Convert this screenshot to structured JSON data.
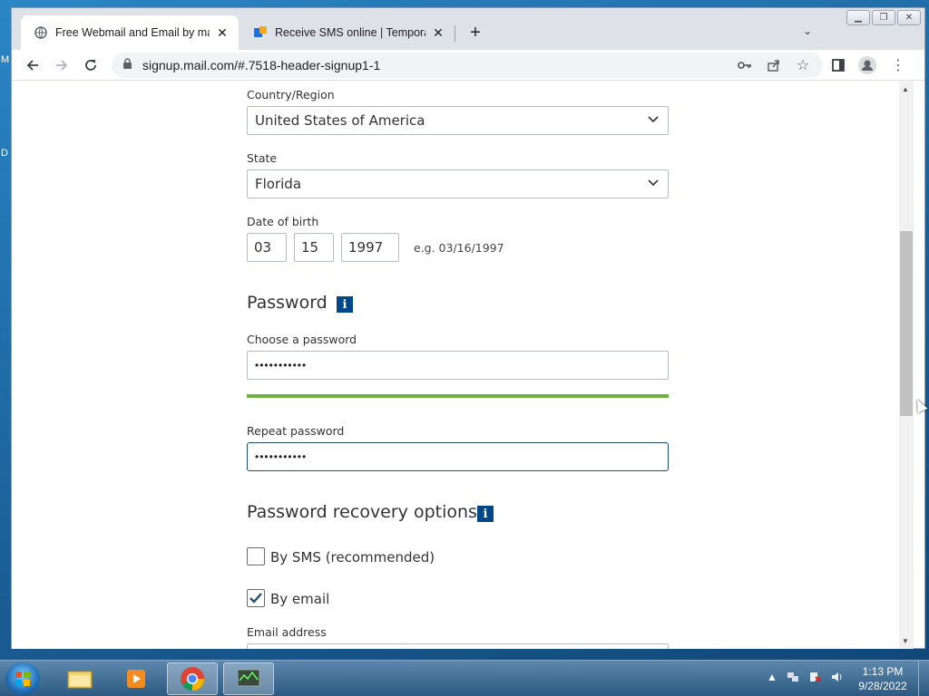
{
  "desktop": {
    "letters": [
      "M",
      "D"
    ]
  },
  "browser": {
    "tabs": [
      {
        "title": "Free Webmail and Email by mail.",
        "favicon": "globe-icon",
        "active": true
      },
      {
        "title": "Receive SMS online | Temporary N",
        "favicon": "sms-site-icon",
        "active": false
      }
    ],
    "url": "signup.mail.com/#.7518-header-signup1-1"
  },
  "form": {
    "country_label": "Country/Region",
    "country_value": "United States of America",
    "state_label": "State",
    "state_value": "Florida",
    "dob_label": "Date of birth",
    "dob_month": "03",
    "dob_day": "15",
    "dob_year": "1997",
    "dob_hint": "e.g. 03/16/1997",
    "password_section": "Password",
    "choose_password_label": "Choose a password",
    "choose_password_value": "•••••••••••",
    "password_strength": 1.0,
    "repeat_password_label": "Repeat password",
    "repeat_password_value": "•••••••••••",
    "recovery_section": "Password recovery options",
    "sms_label": "By SMS (recommended)",
    "sms_checked": false,
    "email_label": "By email",
    "email_checked": true,
    "email_address_label": "Email address",
    "info_glyph": "i"
  },
  "taskbar": {
    "time": "1:13 PM",
    "date": "9/28/2022",
    "apps": [
      "explorer-icon",
      "media-player-icon",
      "chrome-icon",
      "task-manager-icon"
    ]
  },
  "colors": {
    "accent": "#004788",
    "strength_bar": "#6cb33f"
  }
}
